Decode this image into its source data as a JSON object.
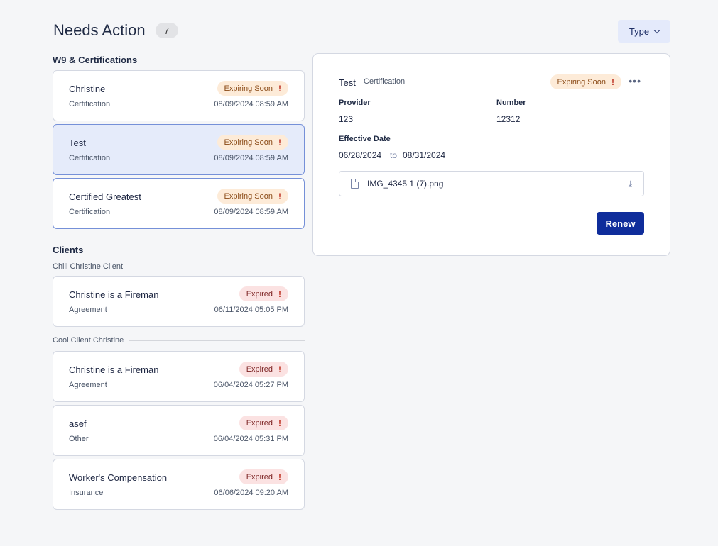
{
  "header": {
    "title": "Needs Action",
    "count": "7",
    "type_filter_label": "Type"
  },
  "sections": {
    "w9": {
      "title": "W9 & Certifications",
      "cards": [
        {
          "title": "Christine",
          "subtitle": "Certification",
          "badge": "Expiring Soon",
          "date": "08/09/2024 08:59 AM"
        },
        {
          "title": "Test",
          "subtitle": "Certification",
          "badge": "Expiring Soon",
          "date": "08/09/2024 08:59 AM"
        },
        {
          "title": "Certified Greatest",
          "subtitle": "Certification",
          "badge": "Expiring Soon",
          "date": "08/09/2024 08:59 AM"
        }
      ]
    },
    "clients": {
      "title": "Clients",
      "groups": [
        {
          "label": "Chill Christine Client",
          "cards": [
            {
              "title": "Christine is a Fireman",
              "subtitle": "Agreement",
              "badge": "Expired",
              "date": "06/11/2024 05:05 PM"
            }
          ]
        },
        {
          "label": "Cool Client Christine",
          "cards": [
            {
              "title": "Christine is a Fireman",
              "subtitle": "Agreement",
              "badge": "Expired",
              "date": "06/04/2024 05:27 PM"
            },
            {
              "title": "asef",
              "subtitle": "Other",
              "badge": "Expired",
              "date": "06/04/2024 05:31 PM"
            },
            {
              "title": "Worker's Compensation",
              "subtitle": "Insurance",
              "badge": "Expired",
              "date": "06/06/2024 09:20 AM"
            }
          ]
        }
      ]
    }
  },
  "detail": {
    "title": "Test",
    "type": "Certification",
    "badge": "Expiring Soon",
    "provider_label": "Provider",
    "provider_value": "123",
    "number_label": "Number",
    "number_value": "12312",
    "effective_label": "Effective Date",
    "effective_from": "06/28/2024",
    "to_word": "to",
    "effective_to": "08/31/2024",
    "file_name": "IMG_4345 1 (7).png",
    "renew_label": "Renew",
    "more_icon": "more-horizontal-icon",
    "file_icon": "file-icon",
    "download_icon": "download-icon"
  },
  "colors": {
    "accent": "#0f2d9b",
    "selected_bg": "#e5ebfa",
    "expiring_bg": "#fdebd8",
    "expired_bg": "#fbe2e2",
    "alert": "#c0392b"
  }
}
